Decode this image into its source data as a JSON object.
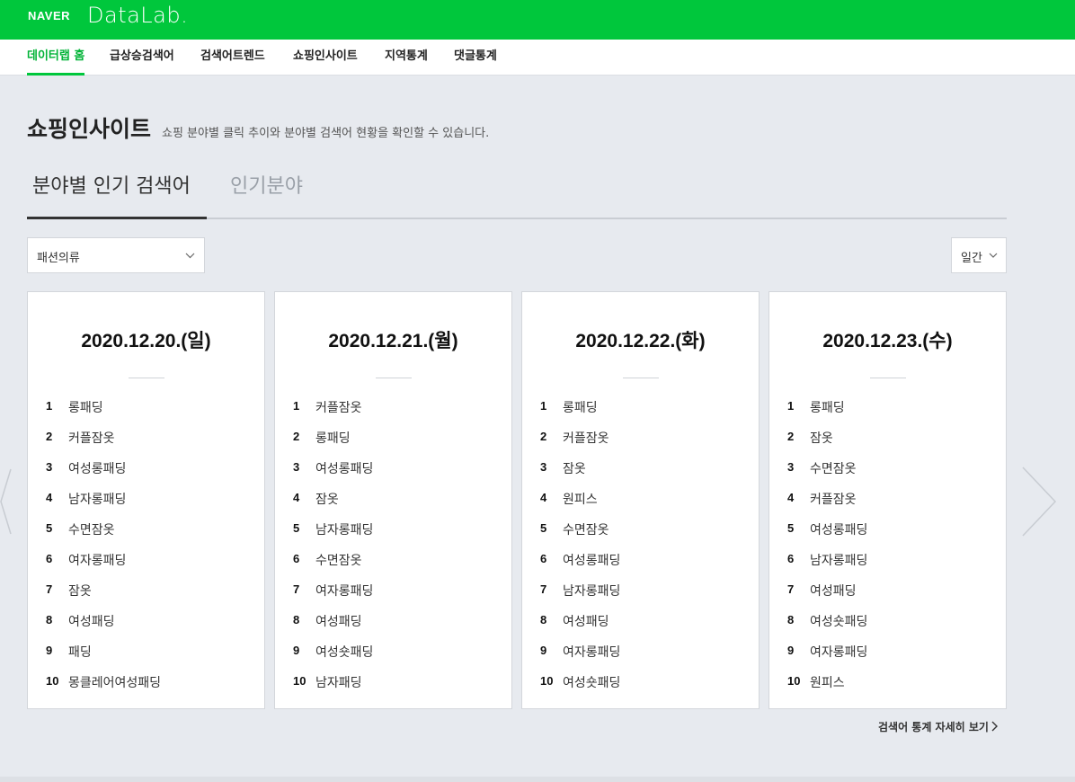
{
  "brand": {
    "naver": "NAVER",
    "product": "DataLab."
  },
  "nav": {
    "items": [
      {
        "label": "데이터랩 홈",
        "active": true
      },
      {
        "label": "급상승검색어",
        "active": false
      },
      {
        "label": "검색어트렌드",
        "active": false
      },
      {
        "label": "쇼핑인사이트",
        "active": false
      },
      {
        "label": "지역통계",
        "active": false
      },
      {
        "label": "댓글통계",
        "active": false
      }
    ]
  },
  "page": {
    "title": "쇼핑인사이트",
    "description": "쇼핑 분야별 클릭 추이와 분야별 검색어 현황을 확인할 수 있습니다."
  },
  "tabs": [
    {
      "label": "분야별 인기 검색어",
      "active": true
    },
    {
      "label": "인기분야",
      "active": false
    }
  ],
  "category_select": {
    "value": "패션의류"
  },
  "period_select": {
    "value": "일간"
  },
  "cards": [
    {
      "date": "2020.12.20.(일)",
      "ranks": [
        {
          "rank": "1",
          "term": "롱패딩"
        },
        {
          "rank": "2",
          "term": "커플잠옷"
        },
        {
          "rank": "3",
          "term": "여성롱패딩"
        },
        {
          "rank": "4",
          "term": "남자롱패딩"
        },
        {
          "rank": "5",
          "term": "수면잠옷"
        },
        {
          "rank": "6",
          "term": "여자롱패딩"
        },
        {
          "rank": "7",
          "term": "잠옷"
        },
        {
          "rank": "8",
          "term": "여성패딩"
        },
        {
          "rank": "9",
          "term": "패딩"
        },
        {
          "rank": "10",
          "term": "몽클레어여성패딩"
        }
      ]
    },
    {
      "date": "2020.12.21.(월)",
      "ranks": [
        {
          "rank": "1",
          "term": "커플잠옷"
        },
        {
          "rank": "2",
          "term": "롱패딩"
        },
        {
          "rank": "3",
          "term": "여성롱패딩"
        },
        {
          "rank": "4",
          "term": "잠옷"
        },
        {
          "rank": "5",
          "term": "남자롱패딩"
        },
        {
          "rank": "6",
          "term": "수면잠옷"
        },
        {
          "rank": "7",
          "term": "여자롱패딩"
        },
        {
          "rank": "8",
          "term": "여성패딩"
        },
        {
          "rank": "9",
          "term": "여성숏패딩"
        },
        {
          "rank": "10",
          "term": "남자패딩"
        }
      ]
    },
    {
      "date": "2020.12.22.(화)",
      "ranks": [
        {
          "rank": "1",
          "term": "롱패딩"
        },
        {
          "rank": "2",
          "term": "커플잠옷"
        },
        {
          "rank": "3",
          "term": "잠옷"
        },
        {
          "rank": "4",
          "term": "원피스"
        },
        {
          "rank": "5",
          "term": "수면잠옷"
        },
        {
          "rank": "6",
          "term": "여성롱패딩"
        },
        {
          "rank": "7",
          "term": "남자롱패딩"
        },
        {
          "rank": "8",
          "term": "여성패딩"
        },
        {
          "rank": "9",
          "term": "여자롱패딩"
        },
        {
          "rank": "10",
          "term": "여성숏패딩"
        }
      ]
    },
    {
      "date": "2020.12.23.(수)",
      "ranks": [
        {
          "rank": "1",
          "term": "롱패딩"
        },
        {
          "rank": "2",
          "term": "잠옷"
        },
        {
          "rank": "3",
          "term": "수면잠옷"
        },
        {
          "rank": "4",
          "term": "커플잠옷"
        },
        {
          "rank": "5",
          "term": "여성롱패딩"
        },
        {
          "rank": "6",
          "term": "남자롱패딩"
        },
        {
          "rank": "7",
          "term": "여성패딩"
        },
        {
          "rank": "8",
          "term": "여성숏패딩"
        },
        {
          "rank": "9",
          "term": "여자롱패딩"
        },
        {
          "rank": "10",
          "term": "원피스"
        }
      ]
    }
  ],
  "more_link": {
    "label": "검색어 통계 자세히 보기"
  },
  "icons": {
    "chevron_down": "chevron-down-icon",
    "chevron_left": "chevron-left-icon",
    "chevron_right": "chevron-right-icon"
  },
  "colors": {
    "brand_green": "#00c73c",
    "active_nav": "#00b336",
    "background": "#e7eaef"
  }
}
